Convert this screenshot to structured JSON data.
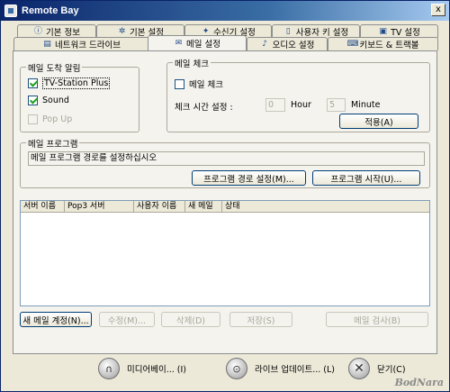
{
  "window": {
    "title": "Remote Bay",
    "close_glyph": "x"
  },
  "tabs_row1": [
    {
      "label": "기본 정보",
      "icon": "info-icon"
    },
    {
      "label": "기본 설정",
      "icon": "gear-icon"
    },
    {
      "label": "수신기 설정",
      "icon": "receiver-icon"
    },
    {
      "label": "사용자 키 설정",
      "icon": "remote-icon"
    },
    {
      "label": "TV 설정",
      "icon": "tv-icon"
    }
  ],
  "tabs_row2": [
    {
      "label": "네트워크 드라이브",
      "icon": "network-drive-icon"
    },
    {
      "label": "메일 설정",
      "icon": "mail-icon",
      "active": true
    },
    {
      "label": "오디오 설정",
      "icon": "audio-icon"
    },
    {
      "label": "키보드 & 트랙볼",
      "icon": "keyboard-icon"
    }
  ],
  "mail_alert": {
    "title": "메일 도착 알림",
    "tv_station": {
      "label": "TV-Station Plus",
      "checked": true
    },
    "sound": {
      "label": "Sound",
      "checked": true
    },
    "popup": {
      "label": "Pop Up",
      "checked": false,
      "disabled": true
    }
  },
  "mail_check": {
    "title": "메일 체크",
    "enable": {
      "label": "메일 체크",
      "checked": false
    },
    "interval_label": "체크 시간 설정 :",
    "hour_value": "0",
    "hour_unit": "Hour",
    "minute_value": "5",
    "minute_unit": "Minute",
    "apply_label": "적용(A)"
  },
  "mail_program": {
    "title": "메일 프로그램",
    "path_text": "메일 프로그램 경로를 설정하십시오",
    "set_path_label": "프로그램 경로 설정(M)...",
    "start_label": "프로그램 시작(U)..."
  },
  "account_list": {
    "columns": [
      "서버 이름",
      "Pop3 서버",
      "사용자 이름",
      "새 메일",
      "상태"
    ],
    "rows": []
  },
  "account_buttons": {
    "new": "새 메일 계정(N)...",
    "edit": "수정(M)...",
    "delete": "삭제(D)",
    "save": "저장(S)",
    "check": "메일 검사(B)"
  },
  "footer": {
    "media": "미디어베이... (I)",
    "live_update": "라이브 업데이트... (L)",
    "close": "닫기(C)",
    "watermark": "BodNara"
  }
}
